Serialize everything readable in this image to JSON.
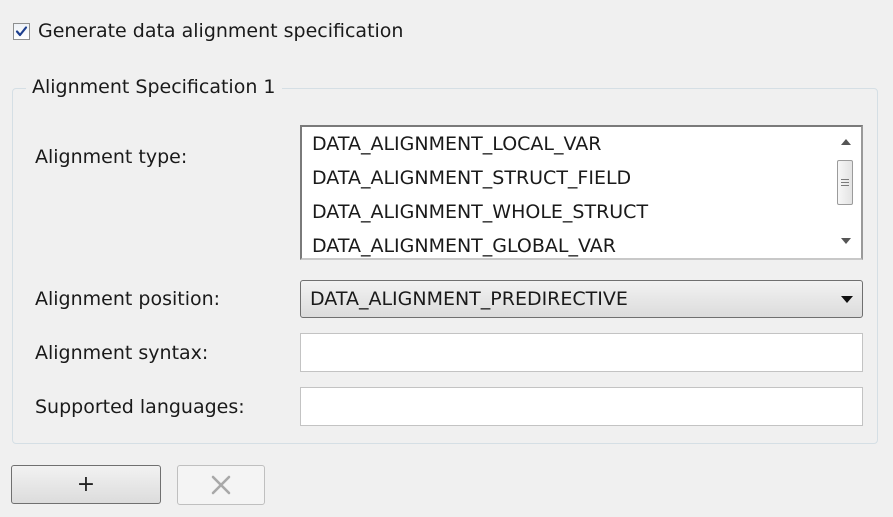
{
  "generate": {
    "checked": true,
    "label": "Generate data alignment specification"
  },
  "group": {
    "title": "Alignment Specification 1"
  },
  "alignment_type": {
    "label": "Alignment type:",
    "options": [
      "DATA_ALIGNMENT_LOCAL_VAR",
      "DATA_ALIGNMENT_STRUCT_FIELD",
      "DATA_ALIGNMENT_WHOLE_STRUCT",
      "DATA_ALIGNMENT_GLOBAL_VAR"
    ]
  },
  "alignment_position": {
    "label": "Alignment position:",
    "value": "DATA_ALIGNMENT_PREDIRECTIVE"
  },
  "alignment_syntax": {
    "label": "Alignment syntax:",
    "value": ""
  },
  "supported_languages": {
    "label": "Supported languages:",
    "value": ""
  },
  "buttons": {
    "add_label": "+",
    "remove_icon": "x-icon"
  },
  "colors": {
    "check_mark": "#1d3f8e",
    "group_border": "#d5dfe5",
    "background": "#f0f0f0"
  }
}
